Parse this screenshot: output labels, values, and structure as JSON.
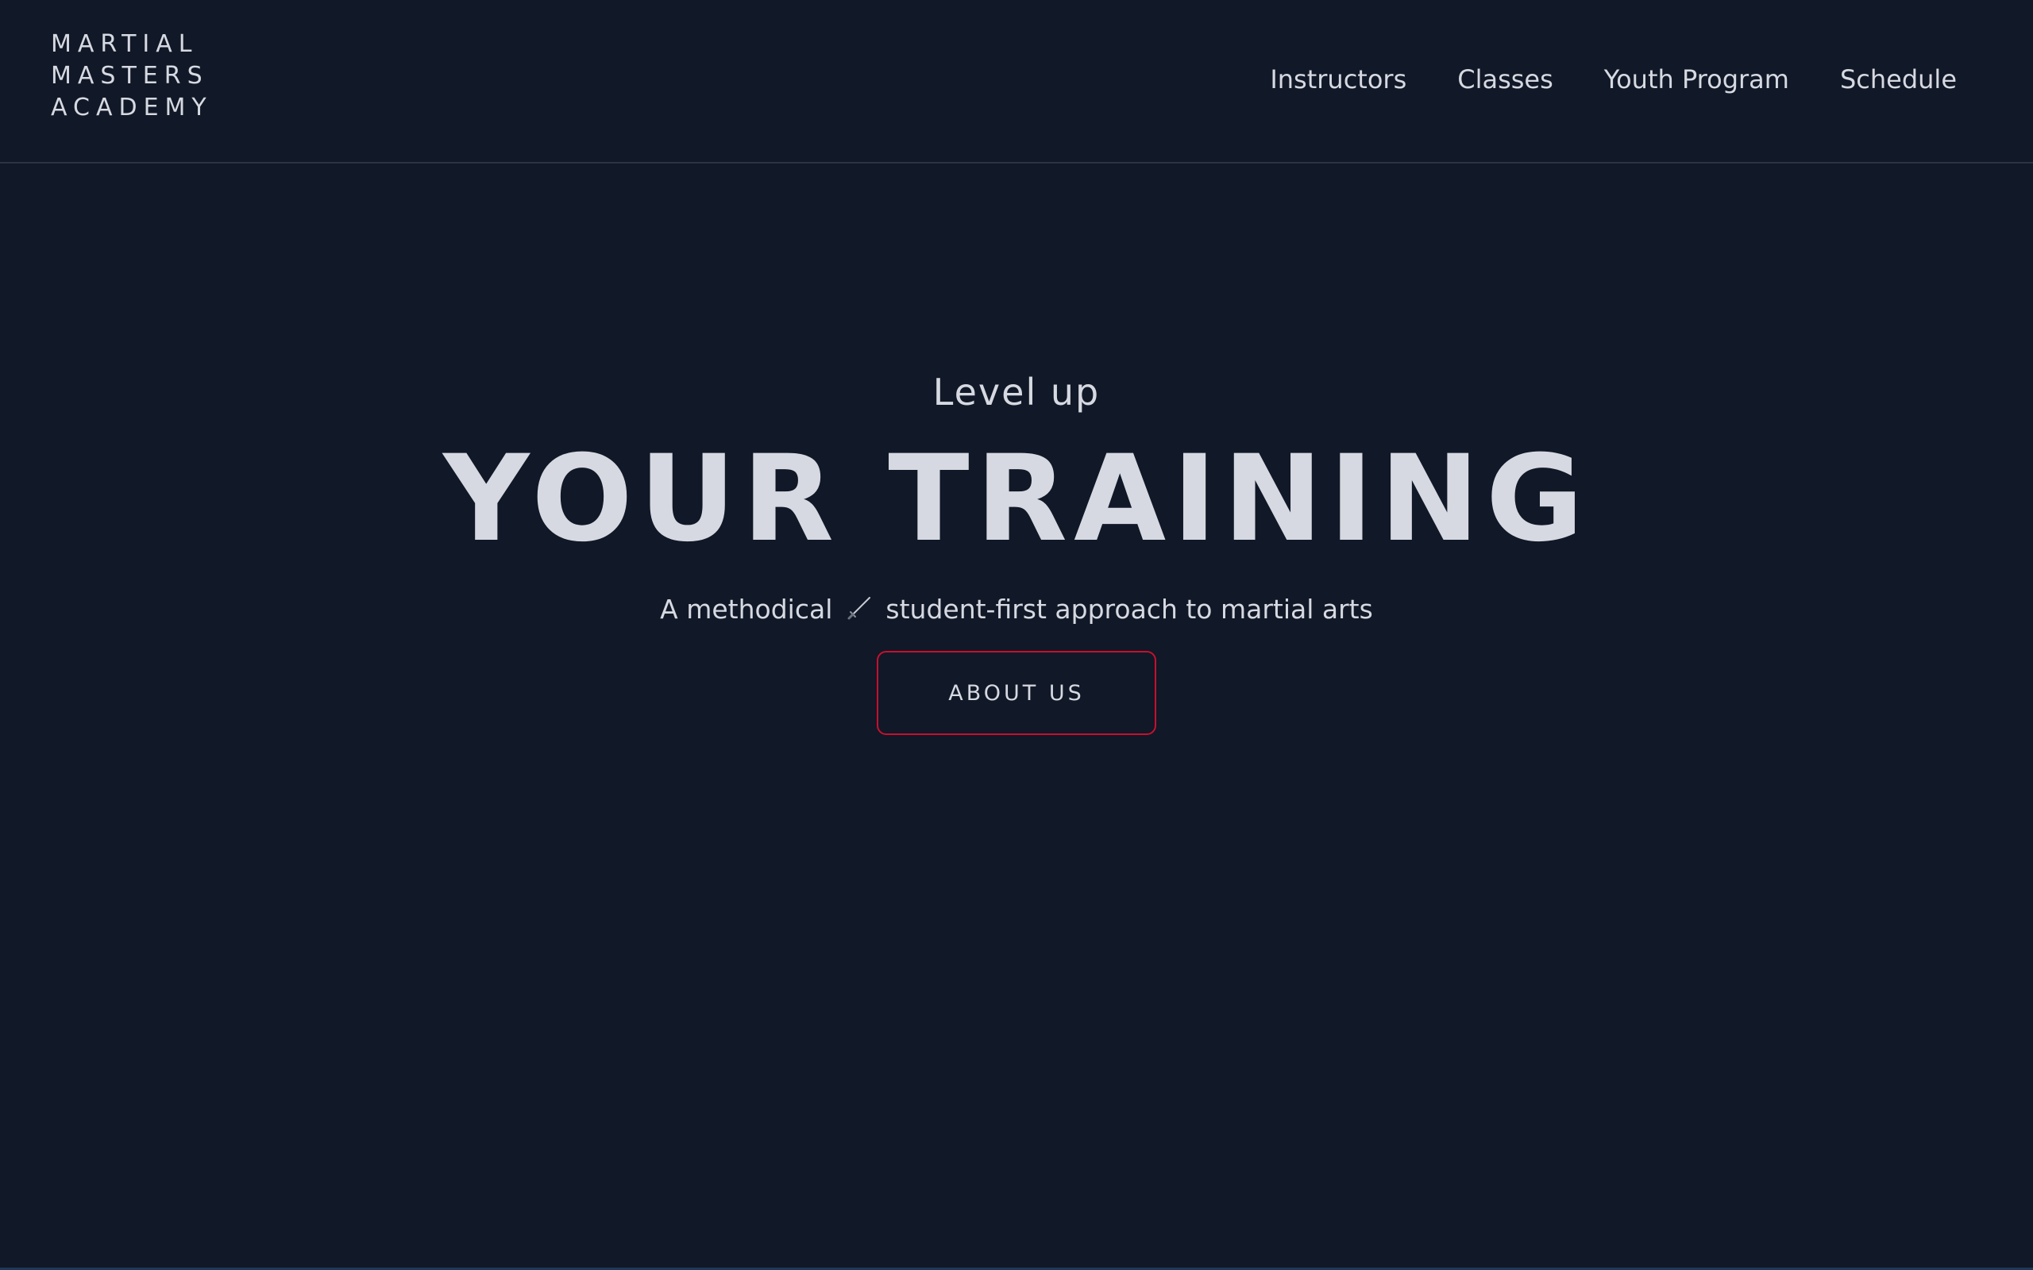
{
  "brand": {
    "line1": "MARTIAL",
    "line2": "MASTERS",
    "line3": "ACADEMY"
  },
  "nav": {
    "items": [
      {
        "label": "Instructors"
      },
      {
        "label": "Classes"
      },
      {
        "label": "Youth Program"
      },
      {
        "label": "Schedule"
      }
    ]
  },
  "hero": {
    "eyebrow": "Level up",
    "headline": "YOUR TRAINING",
    "tagline_before": "A methodical",
    "tagline_icon": "sword-icon",
    "tagline_after": "student-first approach to martial arts",
    "cta_label": "ABOUT US"
  },
  "colors": {
    "background": "#111827",
    "text": "#d6d9e1",
    "accent": "#c8102e",
    "divider": "#2b3444"
  }
}
